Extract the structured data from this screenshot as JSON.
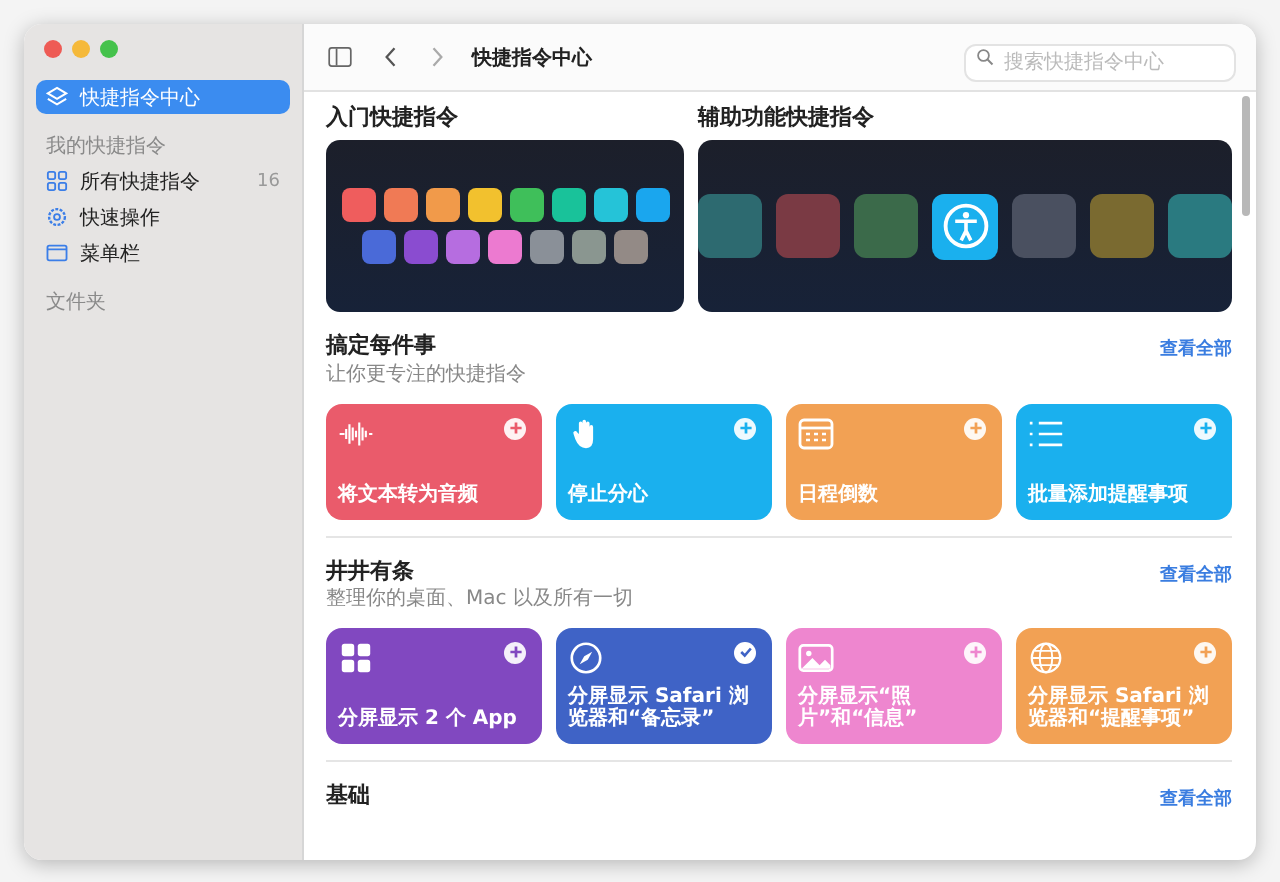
{
  "window": {
    "title": "快捷指令中心"
  },
  "search": {
    "placeholder": "搜索快捷指令中心"
  },
  "sidebar": {
    "items": [
      {
        "label": "快捷指令中心",
        "kind": "stack",
        "selected": true
      }
    ],
    "sections": [
      {
        "title": "我的快捷指令",
        "items": [
          {
            "label": "所有快捷指令",
            "kind": "grid",
            "count": "16",
            "selected": false
          },
          {
            "label": "快速操作",
            "kind": "gear",
            "selected": false
          },
          {
            "label": "菜单栏",
            "kind": "window",
            "selected": false
          }
        ]
      },
      {
        "title": "文件夹"
      }
    ]
  },
  "featured": [
    {
      "title": "入门快捷指令",
      "kind": "starter"
    },
    {
      "title": "辅助功能快捷指令",
      "kind": "accessibility"
    }
  ],
  "sections": [
    {
      "title": "搞定每件事",
      "subtitle": "让你更专注的快捷指令",
      "see_all": "查看全部",
      "cards": [
        {
          "label": "将文本转为音频",
          "kind": "wave",
          "color": "#ea5b6b",
          "added": false
        },
        {
          "label": "停止分心",
          "kind": "hand",
          "color": "#1ab0ee",
          "added": false
        },
        {
          "label": "日程倒数",
          "kind": "calendar",
          "color": "#f2a154",
          "added": false
        },
        {
          "label": "批量添加提醒事项",
          "kind": "list",
          "color": "#1ab0ee",
          "added": false
        }
      ]
    },
    {
      "title": "井井有条",
      "subtitle": "整理你的桌面、Mac 以及所有一切",
      "see_all": "查看全部",
      "cards": [
        {
          "label": "分屏显示 2 个 App",
          "kind": "grid",
          "color": "#8148c0",
          "added": false
        },
        {
          "label": "分屏显示 Safari 浏览器和“备忘录”",
          "kind": "compass",
          "color": "#3f63c6",
          "added": true
        },
        {
          "label": "分屏显示“照片”和“信息”",
          "kind": "photo",
          "color": "#ee86cf",
          "added": false
        },
        {
          "label": "分屏显示 Safari 浏览器和“提醒事项”",
          "kind": "globe",
          "color": "#f2a154",
          "added": false
        }
      ]
    },
    {
      "title": "基础",
      "see_all": "查看全部"
    }
  ]
}
